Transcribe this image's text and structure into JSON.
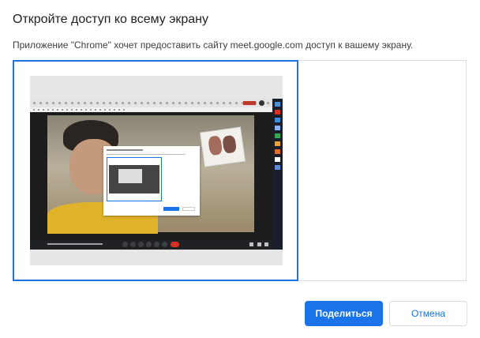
{
  "dialog": {
    "title": "Откройте доступ ко всему экрану",
    "subtitle": "Приложение \"Chrome\" хочет предоставить сайту meet.google.com доступ к вашему экрану."
  },
  "sources": [
    {
      "kind": "entire-screen",
      "selected": true
    }
  ],
  "colors": {
    "accent": "#1a73e8",
    "border": "#dadce0",
    "title": "#202124"
  },
  "buttons": {
    "share": "Поделиться",
    "cancel": "Отмена"
  }
}
